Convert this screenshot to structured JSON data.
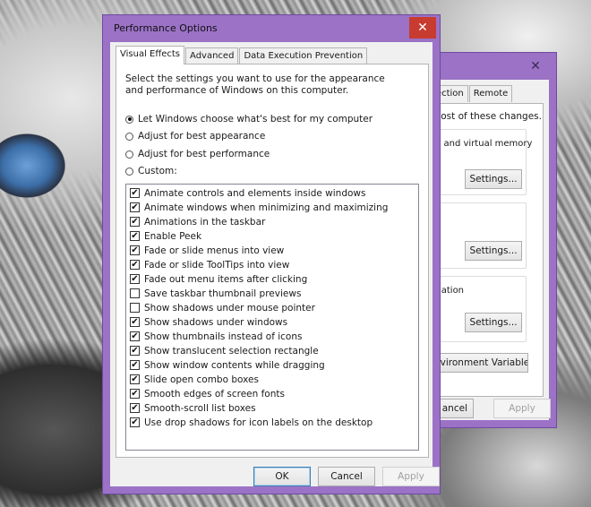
{
  "back_window": {
    "close_glyph": "✕",
    "tabs": [
      "tection",
      "Remote"
    ],
    "admin_note": "most of these changes.",
    "performance_text": "e, and virtual memory",
    "settings_label": "Settings...",
    "startup_text": "mation",
    "env_button": "nvironment Variables...",
    "cancel_label": "ancel",
    "apply_label": "Apply"
  },
  "dialog": {
    "title": "Performance Options",
    "close_glyph": "✕",
    "tabs": [
      "Visual Effects",
      "Advanced",
      "Data Execution Prevention"
    ],
    "intro": "Select the settings you want to use for the appearance and performance of Windows on this computer.",
    "options": [
      {
        "label": "Let Windows choose what's best for my computer",
        "selected": true
      },
      {
        "label": "Adjust for best appearance",
        "selected": false
      },
      {
        "label": "Adjust for best performance",
        "selected": false
      },
      {
        "label": "Custom:",
        "selected": false
      }
    ],
    "effects": [
      {
        "label": "Animate controls and elements inside windows",
        "checked": true
      },
      {
        "label": "Animate windows when minimizing and maximizing",
        "checked": true
      },
      {
        "label": "Animations in the taskbar",
        "checked": true
      },
      {
        "label": "Enable Peek",
        "checked": true
      },
      {
        "label": "Fade or slide menus into view",
        "checked": true
      },
      {
        "label": "Fade or slide ToolTips into view",
        "checked": true
      },
      {
        "label": "Fade out menu items after clicking",
        "checked": true
      },
      {
        "label": "Save taskbar thumbnail previews",
        "checked": false
      },
      {
        "label": "Show shadows under mouse pointer",
        "checked": false
      },
      {
        "label": "Show shadows under windows",
        "checked": true
      },
      {
        "label": "Show thumbnails instead of icons",
        "checked": true
      },
      {
        "label": "Show translucent selection rectangle",
        "checked": true
      },
      {
        "label": "Show window contents while dragging",
        "checked": true
      },
      {
        "label": "Slide open combo boxes",
        "checked": true
      },
      {
        "label": "Smooth edges of screen fonts",
        "checked": true
      },
      {
        "label": "Smooth-scroll list boxes",
        "checked": true
      },
      {
        "label": "Use drop shadows for icon labels on the desktop",
        "checked": true
      }
    ],
    "ok_label": "OK",
    "cancel_label": "Cancel",
    "apply_label": "Apply"
  }
}
